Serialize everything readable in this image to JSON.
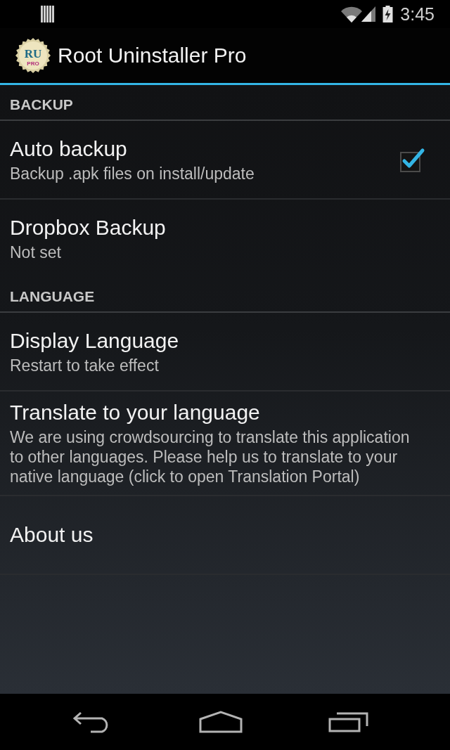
{
  "status_bar": {
    "time": "3:45"
  },
  "action_bar": {
    "logo": {
      "initials": "RU",
      "tag": "PRO"
    },
    "title": "Root Uninstaller Pro"
  },
  "sections": [
    {
      "header": "BACKUP",
      "items": [
        {
          "kind": "checkbox",
          "title": "Auto backup",
          "summary": "Backup .apk files on install/update",
          "checked": true
        },
        {
          "kind": "plain",
          "title": "Dropbox Backup",
          "summary": "Not set"
        }
      ]
    },
    {
      "header": "LANGUAGE",
      "items": [
        {
          "kind": "plain",
          "title": "Display Language",
          "summary": "Restart to take effect"
        },
        {
          "kind": "plain",
          "title": "Translate to your language",
          "summary": "We are using crowdsourcing to translate this application to other languages. Please help us to translate to your native language (click to open Translation Portal)"
        },
        {
          "kind": "plain",
          "title": "About us"
        }
      ]
    }
  ]
}
